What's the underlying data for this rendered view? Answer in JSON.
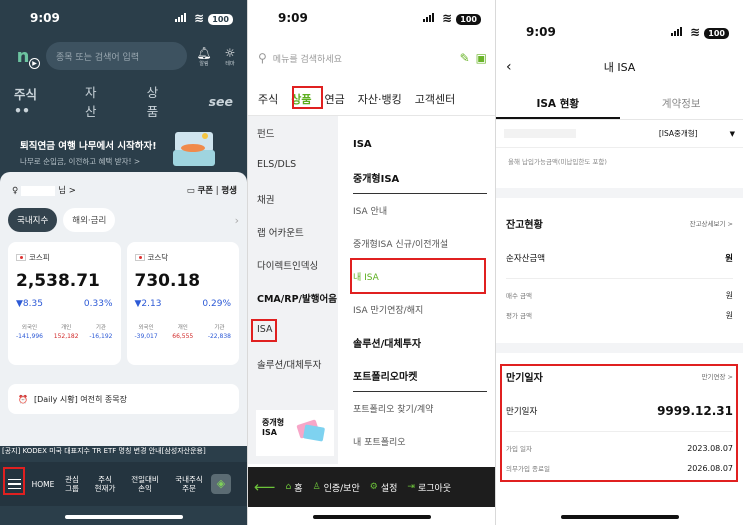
{
  "status_time": "9:09",
  "battery": "100",
  "left": {
    "logo_letter": "n",
    "search_placeholder": "종목 또는 검색어 입력",
    "bell_label": "알림",
    "theme_label": "테마",
    "nav": [
      "주식",
      "자산",
      "상품",
      "see"
    ],
    "banner_title": "퇴직연금 여행 나무에서 시작하자!",
    "banner_sub": "나무로 순입금, 이전하고 혜택 받자! >",
    "user_suffix": "님 >",
    "coupon": "쿠폰",
    "grade": "평생",
    "tab_domestic": "국내지수",
    "tab_global": "해외·금리",
    "kospi": {
      "name": "코스피",
      "value": "2,538.71",
      "change": "▼8.35",
      "pct": "0.33%",
      "inv_labels": [
        "외국인",
        "개인",
        "기관"
      ],
      "inv_values": [
        "-141,996",
        "152,182",
        "-16,192"
      ]
    },
    "kosdaq": {
      "name": "코스닥",
      "value": "730.18",
      "change": "▼2.13",
      "pct": "0.29%",
      "inv_labels": [
        "외국인",
        "개인",
        "기관"
      ],
      "inv_values": [
        "-39,017",
        "66,555",
        "-22,838"
      ]
    },
    "daily": "[Daily 시황] 여전히 종목장",
    "notice": "[공지] KODEX 미국 대표지수 TR ETF 명칭 변경 안내[삼성자산운용]",
    "bottom": {
      "home": "HOME",
      "group": "관심\n그룹",
      "holdings": "주식\n현재가",
      "pnl": "전일대비\n손익",
      "order": "국내주식\n주문"
    }
  },
  "middle": {
    "search_placeholder": "메뉴를 검색하세요",
    "tabs": [
      "주식",
      "상품",
      "연금",
      "자산·뱅킹",
      "고객센터"
    ],
    "categories": [
      "펀드",
      "ELS/DLS",
      "채권",
      "랩 어카운트",
      "다이렉트인덱싱",
      "CMA/RP/발행어음",
      "ISA",
      "솔루션/대체투자"
    ],
    "isa_header": "ISA",
    "items": [
      "중개형ISA",
      "ISA 안내",
      "중개형ISA 신규/이전개설",
      "내 ISA",
      "ISA 만기연장/해지"
    ],
    "solution_header": "솔루션/대체투자",
    "portfolio_header": "포트폴리오마켓",
    "portfolio_items": [
      "포트폴리오 찾기/계약",
      "내 포트폴리오"
    ],
    "promo": "중개형\nISA",
    "bottom": {
      "home": "홈",
      "auth": "인증/보안",
      "settings": "설정",
      "logout": "로그아웃"
    }
  },
  "right": {
    "title": "내 ISA",
    "tabs": [
      "ISA 현황",
      "계약정보"
    ],
    "account_type": "[ISA중개형]",
    "note": "올해 납입가능금액(미납입한도 포함)",
    "balance_title": "잔고현황",
    "balance_detail": "잔고상세보기 >",
    "net_assets_label": "순자산금액",
    "net_assets_value": "원",
    "buy_label": "매수 금액",
    "buy_value": "원",
    "eval_label": "평가 금액",
    "eval_value": "원",
    "maturity_title": "만기일자",
    "maturity_extend": "만기연장 >",
    "maturity_label": "만기일자",
    "maturity_value": "9999.12.31",
    "join_label": "가입 일자",
    "join_value": "2023.08.07",
    "mandatory_label": "의무가입 종료일",
    "mandatory_value": "2026.08.07"
  }
}
